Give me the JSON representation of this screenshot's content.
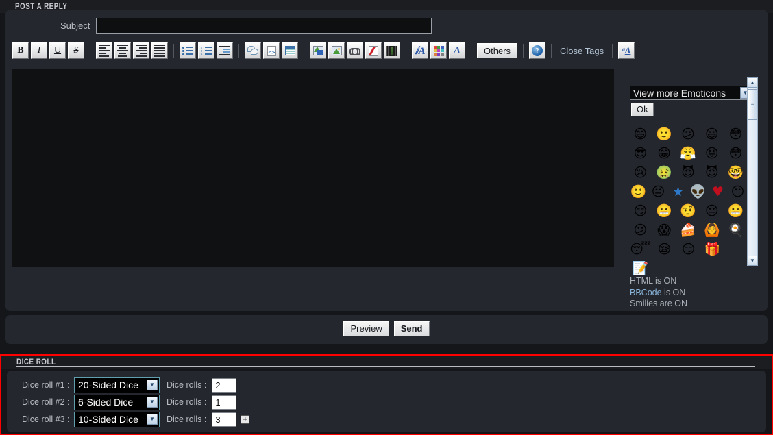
{
  "post": {
    "header": "POST A REPLY",
    "subject_label": "Subject",
    "subject_value": "",
    "subject_placeholder": "",
    "message_value": "",
    "message_placeholder": ""
  },
  "toolbar": {
    "bold": "B",
    "italic": "I",
    "underline": "U",
    "strike": "S",
    "others": "Others",
    "close_tags": "Close Tags",
    "help": "?",
    "font_a": "A",
    "font_color_a": "A"
  },
  "emoticons": {
    "select_value": "View more Emoticons",
    "ok_label": "Ok",
    "grid": [
      [
        "😄",
        "🙂",
        "😕",
        "😃",
        "😳"
      ],
      [
        "😎",
        "😁",
        "😤",
        "😝",
        "😳"
      ],
      [
        "😢",
        "🤢",
        "😈",
        "😈",
        "🤓"
      ],
      [
        "🙂",
        "😐",
        "★",
        "👽",
        "♥",
        "😶"
      ],
      [
        "😏",
        "😬",
        "🤨",
        "😐",
        "😬"
      ],
      [
        "😕",
        "😱",
        "🍰",
        "🙆",
        "🍳"
      ],
      [
        "😴",
        "😪",
        "😏",
        "🎁"
      ],
      [
        "📝"
      ]
    ],
    "html_flag": "HTML is ON",
    "bbcode_flag_prefix": "BBCode",
    "bbcode_flag_suffix": " is ON",
    "smilies_flag": "Smilies are ON"
  },
  "submit": {
    "preview_label": "Preview",
    "send_label": "Send"
  },
  "dice": {
    "header": "DICE ROLL",
    "add_button": "+",
    "rows": [
      {
        "label": "Dice roll #1 :",
        "dice_type": "20-Sided Dice",
        "rolls_label": "Dice rolls :",
        "rolls_value": "2"
      },
      {
        "label": "Dice roll #2 :",
        "dice_type": "6-Sided Dice",
        "rolls_label": "Dice rolls :",
        "rolls_value": "1"
      },
      {
        "label": "Dice roll #3 :",
        "dice_type": "10-Sided Dice",
        "rolls_label": "Dice rolls :",
        "rolls_value": "3"
      }
    ]
  },
  "colors": {
    "page_bg": "#141619",
    "panel_bg": "#24272e",
    "accent_red": "#ff0000",
    "accent_cyan": "#5f9fae",
    "link_blue": "#89b4d8"
  }
}
